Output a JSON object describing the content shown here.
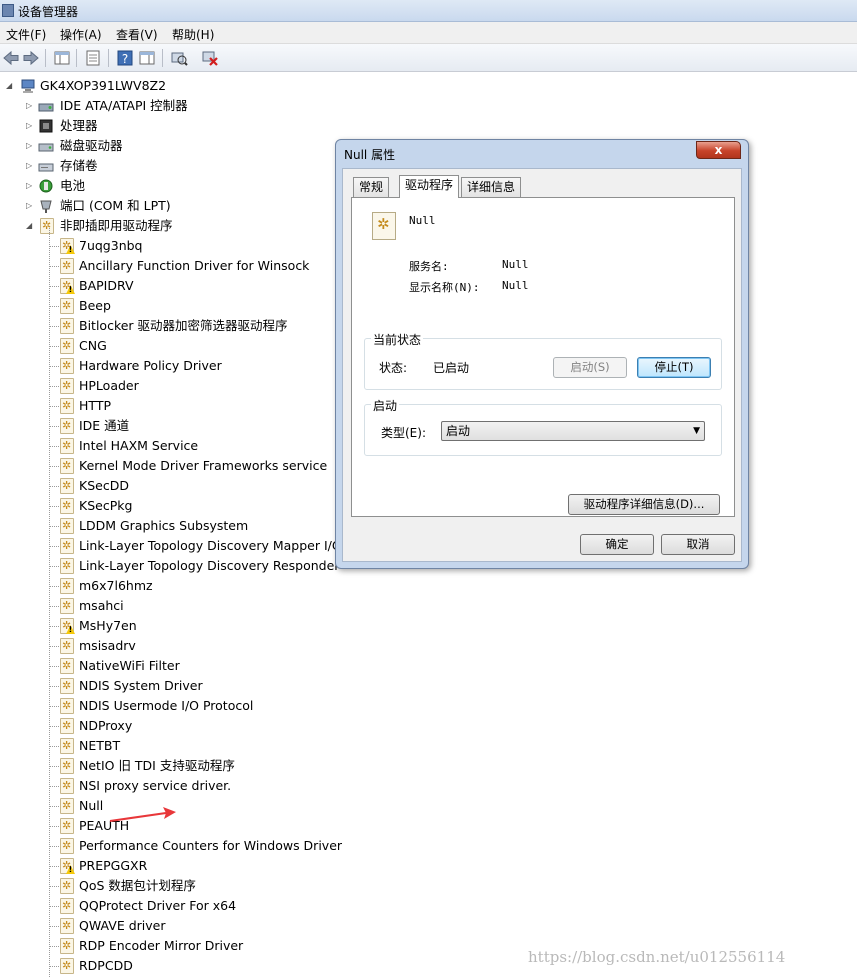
{
  "window": {
    "title": "设备管理器"
  },
  "menu": [
    "文件(F)",
    "操作(A)",
    "查看(V)",
    "帮助(H)"
  ],
  "toolbar_icons": [
    "back-arrow-icon",
    "forward-arrow-icon",
    "console-tree-icon",
    "properties-icon",
    "help-icon",
    "action-pane-icon",
    "scan-hardware-icon",
    "uninstall-icon"
  ],
  "tree": {
    "root": "GK4XOP391LWV8Z2",
    "categories": [
      "IDE ATA/ATAPI 控制器",
      "处理器",
      "磁盘驱动器",
      "存储卷",
      "电池",
      "端口 (COM 和 LPT)",
      "非即插即用驱动程序"
    ],
    "drivers": [
      {
        "label": "7uqg3nbq",
        "warn": true
      },
      {
        "label": "Ancillary Function Driver for Winsock",
        "warn": false
      },
      {
        "label": "BAPIDRV",
        "warn": true
      },
      {
        "label": "Beep",
        "warn": false
      },
      {
        "label": "Bitlocker 驱动器加密筛选器驱动程序",
        "warn": false
      },
      {
        "label": "CNG",
        "warn": false
      },
      {
        "label": "Hardware Policy Driver",
        "warn": false
      },
      {
        "label": "HPLoader",
        "warn": false
      },
      {
        "label": "HTTP",
        "warn": false
      },
      {
        "label": "IDE 通道",
        "warn": false
      },
      {
        "label": "Intel HAXM Service",
        "warn": false
      },
      {
        "label": "Kernel Mode Driver Frameworks service",
        "warn": false
      },
      {
        "label": "KSecDD",
        "warn": false
      },
      {
        "label": "KSecPkg",
        "warn": false
      },
      {
        "label": "LDDM Graphics Subsystem",
        "warn": false
      },
      {
        "label": "Link-Layer Topology Discovery Mapper I/O",
        "warn": false
      },
      {
        "label": "Link-Layer Topology Discovery Responder",
        "warn": false
      },
      {
        "label": "m6x7l6hmz",
        "warn": false
      },
      {
        "label": "msahci",
        "warn": false
      },
      {
        "label": "MsHy7en",
        "warn": true
      },
      {
        "label": "msisadrv",
        "warn": false
      },
      {
        "label": "NativeWiFi Filter",
        "warn": false
      },
      {
        "label": "NDIS System Driver",
        "warn": false
      },
      {
        "label": "NDIS Usermode I/O Protocol",
        "warn": false
      },
      {
        "label": "NDProxy",
        "warn": false
      },
      {
        "label": "NETBT",
        "warn": false
      },
      {
        "label": "NetIO 旧 TDI 支持驱动程序",
        "warn": false
      },
      {
        "label": "NSI proxy service driver.",
        "warn": false
      },
      {
        "label": "Null",
        "warn": false
      },
      {
        "label": "PEAUTH",
        "warn": false
      },
      {
        "label": "Performance Counters for Windows Driver",
        "warn": false
      },
      {
        "label": "PREPGGXR",
        "warn": true
      },
      {
        "label": "QoS 数据包计划程序",
        "warn": false
      },
      {
        "label": "QQProtect Driver For x64",
        "warn": false
      },
      {
        "label": "QWAVE driver",
        "warn": false
      },
      {
        "label": "RDP Encoder Mirror Driver",
        "warn": false
      },
      {
        "label": "RDPCDD",
        "warn": false
      }
    ]
  },
  "dialog": {
    "title": "Null 属性",
    "close": "x",
    "tabs": [
      "常规",
      "驱动程序",
      "详细信息"
    ],
    "active_tab": 1,
    "driver_name": "Null",
    "service_name_label": "服务名:",
    "service_name_value": "Null",
    "display_name_label": "显示名称(N):",
    "display_name_value": "Null",
    "status_group_title": "当前状态",
    "status_label": "状态:",
    "status_value": "已启动",
    "start_button": "启动(S)",
    "stop_button": "停止(T)",
    "startup_group_title": "启动",
    "type_label": "类型(E):",
    "type_value": "启动",
    "details_button": "驱动程序详细信息(D)...",
    "ok_button": "确定",
    "cancel_button": "取消"
  },
  "watermark": "https://blog.csdn.net/u012556114",
  "colors": {
    "annotation_arrow": "#e8373a"
  }
}
